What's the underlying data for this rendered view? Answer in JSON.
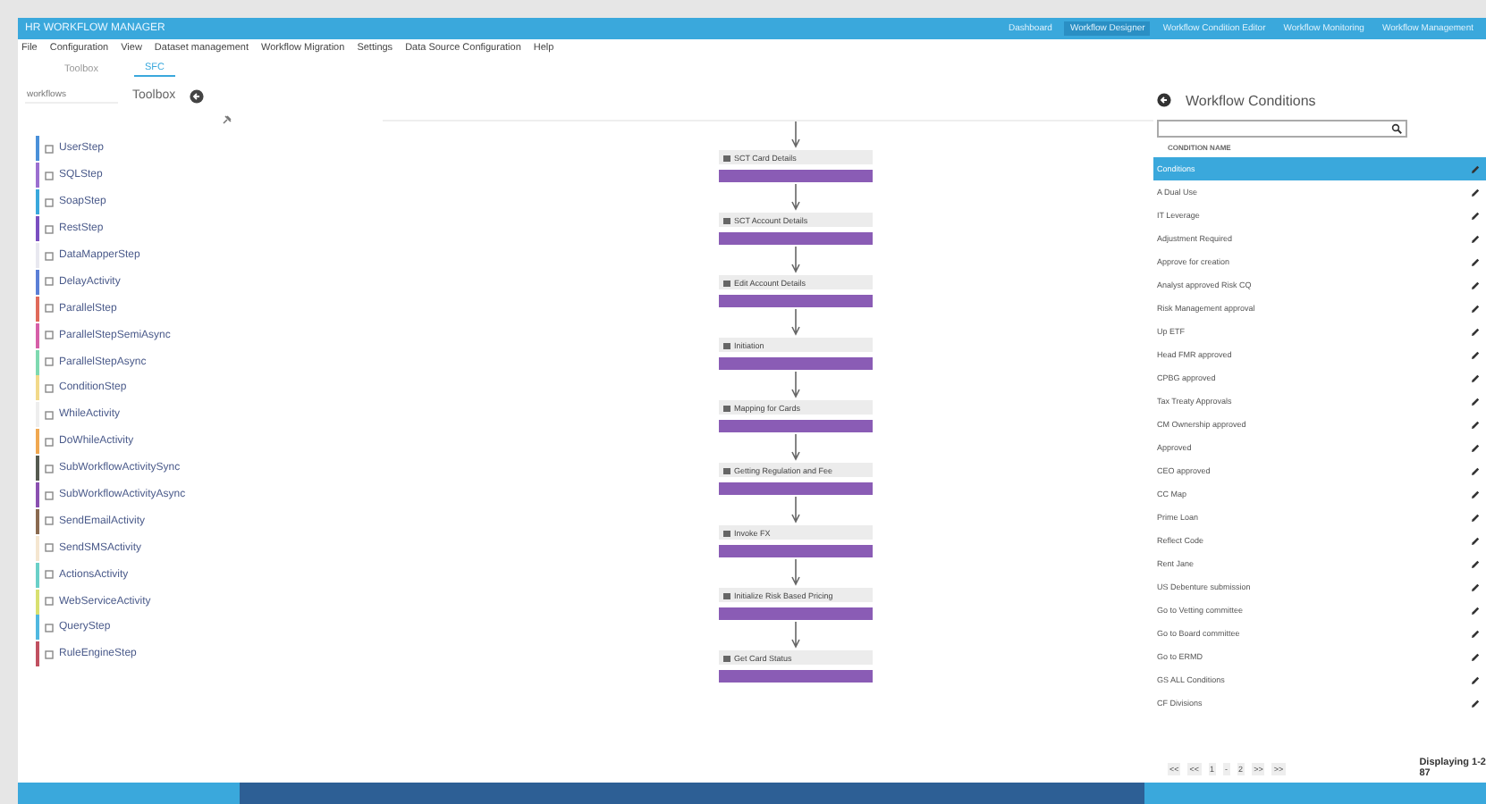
{
  "window": {
    "title": "HR WORKFLOW MANAGER"
  },
  "header_tabs": [
    {
      "label": "Dashboard",
      "selected": false
    },
    {
      "label": "Workflow Designer",
      "selected": true
    },
    {
      "label": "Workflow Condition Editor",
      "selected": false
    },
    {
      "label": "Workflow Monitoring",
      "selected": false
    },
    {
      "label": "Workflow Management",
      "selected": false
    }
  ],
  "menu": [
    "File",
    "Configuration",
    "View",
    "Dataset management",
    "Workflow Migration",
    "Settings",
    "Data Source Configuration",
    "Help"
  ],
  "doc_tabs": [
    {
      "label": "Toolbox",
      "selected": false
    },
    {
      "label": "SFC",
      "selected": true
    }
  ],
  "toolbox": {
    "search": {
      "placeholder": "workflows"
    },
    "title": "Toolbox",
    "items": [
      {
        "label": "UserStep",
        "color": "#4a90d9"
      },
      {
        "label": "SQLStep",
        "color": "#9b6fd0"
      },
      {
        "label": "SoapStep",
        "color": "#3aa8dc"
      },
      {
        "label": "RestStep",
        "color": "#7a4fc0"
      },
      {
        "label": "DataMapperStep",
        "color": "#e8e8f0"
      },
      {
        "label": "DelayActivity",
        "color": "#5b7fd6"
      },
      {
        "label": "ParallelStep",
        "color": "#e06a5a"
      },
      {
        "label": "ParallelStepSemiAsync",
        "color": "#d65fa8"
      },
      {
        "label": "ParallelStepAsync",
        "color": "#7ed9b0"
      },
      {
        "label": "ConditionStep",
        "color": "#f2d98a"
      },
      {
        "label": "WhileActivity",
        "color": "#eeeeee"
      },
      {
        "label": "DoWhileActivity",
        "color": "#f0a850"
      },
      {
        "label": "SubWorkflowActivitySync",
        "color": "#555a50"
      },
      {
        "label": "SubWorkflowActivityAsync",
        "color": "#8a50b0"
      },
      {
        "label": "SendEmailActivity",
        "color": "#8a6a50"
      },
      {
        "label": "SendSMSActivity",
        "color": "#f5e6d0"
      },
      {
        "label": "ActionsActivity",
        "color": "#6ad0c8"
      },
      {
        "label": "WebServiceActivity",
        "color": "#d8e070"
      },
      {
        "label": "QueryStep",
        "color": "#50b8e0"
      },
      {
        "label": "RuleEngineStep",
        "color": "#c05060"
      }
    ]
  },
  "workflow_steps": [
    {
      "label": "SCT Card Details"
    },
    {
      "label": "SCT Account Details"
    },
    {
      "label": "Edit Account Details"
    },
    {
      "label": "Initiation"
    },
    {
      "label": "Mapping for Cards"
    },
    {
      "label": "Getting Regulation and Fee"
    },
    {
      "label": "Invoke FX"
    },
    {
      "label": "Initialize Risk Based Pricing"
    },
    {
      "label": "Get Card Status"
    }
  ],
  "conditions": {
    "title": "Workflow Conditions",
    "column": "CONDITION NAME",
    "rows": [
      {
        "name": "Conditions",
        "selected": true
      },
      {
        "name": "A Dual Use",
        "selected": false
      },
      {
        "name": "IT Leverage",
        "selected": false
      },
      {
        "name": "Adjustment Required",
        "selected": false
      },
      {
        "name": "Approve for creation",
        "selected": false
      },
      {
        "name": "Analyst approved Risk CQ",
        "selected": false
      },
      {
        "name": "Risk Management approval",
        "selected": false
      },
      {
        "name": "Up ETF",
        "selected": false
      },
      {
        "name": "Head FMR approved",
        "selected": false
      },
      {
        "name": "CPBG approved",
        "selected": false
      },
      {
        "name": "Tax Treaty Approvals",
        "selected": false
      },
      {
        "name": "CM Ownership approved",
        "selected": false
      },
      {
        "name": "Approved",
        "selected": false
      },
      {
        "name": "CEO approved",
        "selected": false
      },
      {
        "name": "CC Map",
        "selected": false
      },
      {
        "name": "Prime Loan",
        "selected": false
      },
      {
        "name": "Reflect Code",
        "selected": false
      },
      {
        "name": "Rent Jane",
        "selected": false
      },
      {
        "name": "US Debenture submission",
        "selected": false
      },
      {
        "name": "Go to Vetting committee",
        "selected": false
      },
      {
        "name": "Go to Board committee",
        "selected": false
      },
      {
        "name": "Go to ERMD",
        "selected": false
      },
      {
        "name": "GS ALL Conditions",
        "selected": false
      },
      {
        "name": "CF Divisions",
        "selected": false
      }
    ],
    "pager": [
      "<<",
      "<<",
      "1",
      "-",
      "2",
      ">>",
      ">>"
    ],
    "summary": "Displaying 1-2",
    "summary_total": "87"
  }
}
